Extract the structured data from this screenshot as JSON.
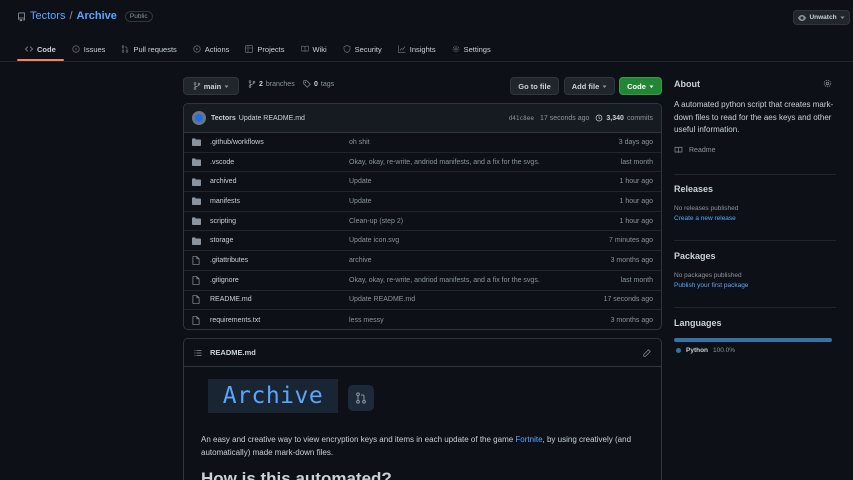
{
  "repo": {
    "owner": "Tectors",
    "separator": "/",
    "name": "Archive",
    "visibility": "Public"
  },
  "header": {
    "unwatch_label": "Unwatch"
  },
  "tabs": [
    {
      "label": "Code",
      "icon": "code-icon"
    },
    {
      "label": "Issues",
      "icon": "issue-icon"
    },
    {
      "label": "Pull requests",
      "icon": "pull-request-icon"
    },
    {
      "label": "Actions",
      "icon": "actions-icon"
    },
    {
      "label": "Projects",
      "icon": "projects-icon"
    },
    {
      "label": "Wiki",
      "icon": "wiki-icon"
    },
    {
      "label": "Security",
      "icon": "shield-icon"
    },
    {
      "label": "Insights",
      "icon": "graph-icon"
    },
    {
      "label": "Settings",
      "icon": "gear-icon"
    }
  ],
  "toolbar": {
    "branch": "main",
    "branches_count": "2",
    "branches_label": "branches",
    "tags_count": "0",
    "tags_label": "tags",
    "go_to_file": "Go to file",
    "add_file": "Add file",
    "code": "Code"
  },
  "commit": {
    "author": "Tectors",
    "message": "Update README.md",
    "sha": "d41c8ee",
    "time": "17 seconds ago",
    "count": "3,340",
    "count_label": "commits"
  },
  "files": [
    {
      "type": "dir",
      "name": ".github/workflows",
      "message": "oh shit",
      "age": "3 days ago"
    },
    {
      "type": "dir",
      "name": ".vscode",
      "message": "Okay, okay, re-write, andriod manifests, and a fix for the svgs.",
      "age": "last month"
    },
    {
      "type": "dir",
      "name": "archived",
      "message": "Update",
      "age": "1 hour ago"
    },
    {
      "type": "dir",
      "name": "manifests",
      "message": "Update",
      "age": "1 hour ago"
    },
    {
      "type": "dir",
      "name": "scripting",
      "message": "Clean-up (step 2)",
      "age": "1 hour ago"
    },
    {
      "type": "dir",
      "name": "storage",
      "message": "Update icon.svg",
      "age": "7 minutes ago"
    },
    {
      "type": "file",
      "name": ".gitattributes",
      "message": "archive",
      "age": "3 months ago"
    },
    {
      "type": "file",
      "name": ".gitignore",
      "message": "Okay, okay, re-write, andriod manifests, and a fix for the svgs.",
      "age": "last month"
    },
    {
      "type": "file",
      "name": "README.md",
      "message": "Update README.md",
      "age": "17 seconds ago"
    },
    {
      "type": "file",
      "name": "requirements.txt",
      "message": "less messy",
      "age": "3 months ago"
    }
  ],
  "readme": {
    "filename": "README.md",
    "logo_text": "Archive",
    "desc_before": "An easy and creative way to view encryption keys and items in each update of the game ",
    "desc_link": "Fortnite",
    "desc_after": ", by using creatively (and automatically) made mark-down files.",
    "heading": "How is this automated?"
  },
  "sidebar": {
    "about_title": "About",
    "about_desc": "A automated python script that creates mark-down files to read for the aes keys and other useful information.",
    "readme_label": "Readme",
    "releases_title": "Releases",
    "releases_none": "No releases published",
    "releases_create": "Create a new release",
    "packages_title": "Packages",
    "packages_none": "No packages published",
    "packages_publish": "Publish your first package",
    "languages_title": "Languages",
    "languages": [
      {
        "name": "Python",
        "percent": "100.0%",
        "color": "#3572A5"
      }
    ]
  },
  "colors": {
    "accent": "#58a6ff",
    "tab_underline": "#f78166",
    "code_button": "#238636"
  }
}
